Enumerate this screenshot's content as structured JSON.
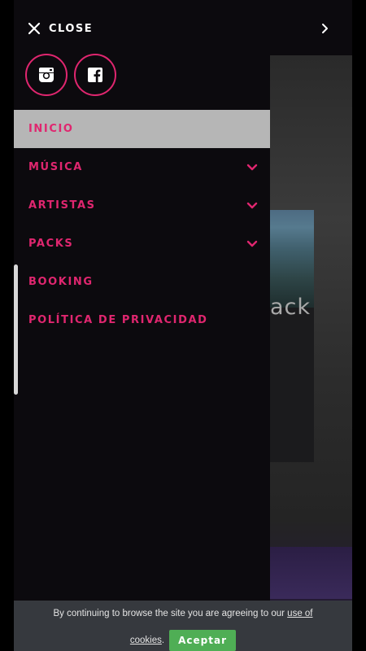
{
  "topbar": {
    "close_label": "CLOSE",
    "close_icon": "close-x-icon",
    "next_icon": "chevron-right-icon"
  },
  "social": [
    {
      "name": "instagram",
      "icon": "instagram-icon"
    },
    {
      "name": "facebook",
      "icon": "facebook-icon"
    }
  ],
  "menu": {
    "items": [
      {
        "label": "INICIO",
        "active": true,
        "has_submenu": false
      },
      {
        "label": "MÚSICA",
        "active": false,
        "has_submenu": true
      },
      {
        "label": "ARTISTAS",
        "active": false,
        "has_submenu": true
      },
      {
        "label": "PACKS",
        "active": false,
        "has_submenu": true
      },
      {
        "label": "BOOKING",
        "active": false,
        "has_submenu": false
      },
      {
        "label": "POLÍTICA DE PRIVACIDAD",
        "active": false,
        "has_submenu": false
      }
    ]
  },
  "background": {
    "partial_text": "ack"
  },
  "cookie": {
    "text_before_link": "By continuing to browse the site you are agreeing to our",
    "link_part1": "use of",
    "link_part2": "cookies",
    "period": ".",
    "accept_label": "Aceptar"
  },
  "colors": {
    "accent": "#e0266f",
    "active_bg": "#b6b6b6",
    "drawer_bg": "#0c0a0e",
    "cookie_bg": "#36393e",
    "accept_bg": "#4fae55"
  }
}
